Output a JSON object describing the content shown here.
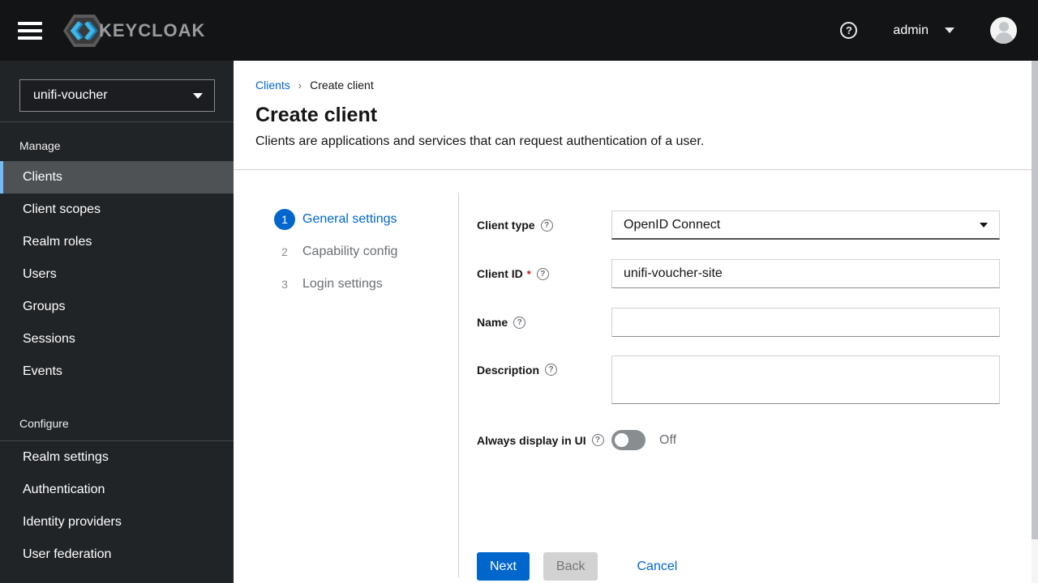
{
  "masthead": {
    "brand": "KEYCLOAK",
    "user": "admin"
  },
  "icons": {
    "question": "?"
  },
  "sidebar": {
    "realm_selector": {
      "value": "unifi-voucher"
    },
    "sections": [
      {
        "label": "Manage",
        "items": [
          {
            "label": "Clients",
            "active": true
          },
          {
            "label": "Client scopes"
          },
          {
            "label": "Realm roles"
          },
          {
            "label": "Users"
          },
          {
            "label": "Groups"
          },
          {
            "label": "Sessions"
          },
          {
            "label": "Events"
          }
        ]
      },
      {
        "label": "Configure",
        "items": [
          {
            "label": "Realm settings"
          },
          {
            "label": "Authentication"
          },
          {
            "label": "Identity providers"
          },
          {
            "label": "User federation"
          }
        ]
      }
    ]
  },
  "breadcrumb": {
    "parent": "Clients",
    "current": "Create client"
  },
  "page": {
    "title": "Create client",
    "subtitle": "Clients are applications and services that can request authentication of a user."
  },
  "wizard": {
    "steps": [
      {
        "number": "1",
        "label": "General settings",
        "active": true
      },
      {
        "number": "2",
        "label": "Capability config",
        "active": false
      },
      {
        "number": "3",
        "label": "Login settings",
        "active": false
      }
    ],
    "form": {
      "client_type": {
        "label": "Client type",
        "value": "OpenID Connect"
      },
      "client_id": {
        "label": "Client ID",
        "required_marker": "*",
        "value": "unifi-voucher-site"
      },
      "name": {
        "label": "Name",
        "value": ""
      },
      "description": {
        "label": "Description",
        "value": ""
      },
      "always_display": {
        "label": "Always display in UI",
        "state": "Off"
      }
    },
    "actions": {
      "next": "Next",
      "back": "Back",
      "cancel": "Cancel"
    }
  },
  "colors": {
    "accent_blue": "#0066cc",
    "sidebar_highlight": "#73bcf7",
    "masthead_bg": "#131416",
    "sidebar_bg": "#212427",
    "sidebar_selected_bg": "#4f5255",
    "required_red": "#c9190b",
    "logo_blue": "#3db7e8"
  }
}
